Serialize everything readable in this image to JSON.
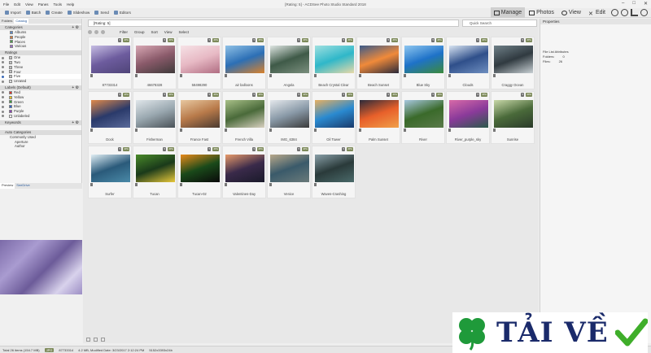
{
  "window": {
    "title": "[Rating: 5] - ACDSee Photo Studio Standard 2018",
    "menu": [
      "File",
      "Edit",
      "View",
      "Panes",
      "Tools",
      "Help"
    ],
    "controls": [
      "–",
      "□",
      "✕"
    ]
  },
  "toolbar": {
    "items": [
      "Import",
      "Batch",
      "Create",
      "Slideshow",
      "Send",
      "Editors"
    ],
    "modes": [
      "Manage",
      "Photos",
      "View",
      "Edit"
    ],
    "mode_active": "Manage"
  },
  "left_panel": {
    "tabs": [
      "Folders",
      "Catalog"
    ],
    "active_tab": "Catalog",
    "categories": {
      "title": "Categories",
      "items": [
        "Albums",
        "People",
        "Places",
        "Various"
      ]
    },
    "ratings": {
      "title": "Ratings",
      "items": [
        "One",
        "Two",
        "Three",
        "Four",
        "Five",
        "Unrated"
      ],
      "selected": "Five"
    },
    "labels": {
      "title": "Labels (Default)",
      "items": [
        {
          "name": "Red",
          "color": "#d9312b"
        },
        {
          "name": "Yellow",
          "color": "#f2c418"
        },
        {
          "name": "Green",
          "color": "#3b9a3b"
        },
        {
          "name": "Blue",
          "color": "#2f5fc8"
        },
        {
          "name": "Purple",
          "color": "#8a3fb3"
        },
        {
          "name": "Unlabeled",
          "color": "#ffffff"
        }
      ]
    },
    "keywords": {
      "title": "Keywords"
    },
    "auto_categories": {
      "title": "Auto Categories",
      "items": [
        "Commonly Used",
        "Aperture",
        "Author"
      ]
    },
    "preview_tabs": [
      "Preview",
      "SeeDrive"
    ]
  },
  "main": {
    "path": "[Rating: 5]",
    "search_placeholder": "Quick Search",
    "filter_bar": [
      "Filter",
      "Group",
      "Sort",
      "View",
      "Select"
    ],
    "thumbnails": [
      {
        "label": "87733314",
        "badges": [
          "5",
          "JPG"
        ],
        "colors": [
          "#6d5c9e",
          "#c6bde3",
          "#4f4478"
        ]
      },
      {
        "label": "46678328",
        "badges": [
          "5",
          "JPG"
        ],
        "colors": [
          "#8a5a6a",
          "#d8a8b4",
          "#3f3a3a"
        ]
      },
      {
        "label": "58498290",
        "badges": [
          "5",
          "JPG"
        ],
        "colors": [
          "#e7b9c4",
          "#f6e2e6",
          "#b06d82"
        ]
      },
      {
        "label": "air balloons",
        "badges": [
          "5",
          "JPG"
        ],
        "colors": [
          "#2c6fb5",
          "#8fc1e6",
          "#d9822c"
        ]
      },
      {
        "label": "Angola",
        "badges": [
          "5",
          "JPG"
        ],
        "colors": [
          "#3f5a48",
          "#dfe6e3",
          "#7b8f7e"
        ]
      },
      {
        "label": "Beach Crystal Clear",
        "badges": [
          "5",
          "JPG"
        ],
        "colors": [
          "#2fb7c9",
          "#9fe0e0",
          "#e8d9a8"
        ]
      },
      {
        "label": "Beach Sunset",
        "badges": [
          "5",
          "JPG"
        ],
        "colors": [
          "#f08a3a",
          "#3a5a8a",
          "#2a2a3a"
        ]
      },
      {
        "label": "Blue Sky",
        "badges": [
          "5",
          "JPG"
        ],
        "colors": [
          "#1e72c8",
          "#8ec7f0",
          "#3c8a3c"
        ]
      },
      {
        "label": "Clouds",
        "badges": [
          "5",
          "JPG"
        ],
        "colors": [
          "#2f4f8a",
          "#d8e4f2",
          "#6f8fc0"
        ]
      },
      {
        "label": "Craggy Ocean",
        "badges": [
          "5",
          "JPG"
        ],
        "colors": [
          "#303a40",
          "#6f8088",
          "#c8d0d4"
        ]
      },
      {
        "label": "Dock",
        "badges": [
          "5",
          "JPG"
        ],
        "colors": [
          "#2a3a6a",
          "#e08a4a",
          "#5a6a9a"
        ]
      },
      {
        "label": "Fisherman",
        "badges": [
          "5",
          "JPG"
        ],
        "colors": [
          "#9aa8b0",
          "#e0e6ea",
          "#4a5258"
        ]
      },
      {
        "label": "France Fast",
        "badges": [
          "5",
          "JPG"
        ],
        "colors": [
          "#b87a4a",
          "#e8c8a0",
          "#4a3a30"
        ]
      },
      {
        "label": "French Villa",
        "badges": [
          "5",
          "JPG"
        ],
        "colors": [
          "#4a6a3a",
          "#a8c088",
          "#d8d0c0"
        ]
      },
      {
        "label": "IMG_6384",
        "badges": [
          "5",
          "JPG"
        ],
        "colors": [
          "#8a9aa8",
          "#e4e8ec",
          "#3a3a3a"
        ]
      },
      {
        "label": "Oil Tower",
        "badges": [
          "5",
          "JPG"
        ],
        "colors": [
          "#2a8ad0",
          "#e8b060",
          "#1a3a6a"
        ]
      },
      {
        "label": "Palm Sunset",
        "badges": [
          "5",
          "JPG"
        ],
        "colors": [
          "#e8602a",
          "#2a2a3a",
          "#f0a04a"
        ]
      },
      {
        "label": "River",
        "badges": [
          "5",
          "JPG"
        ],
        "colors": [
          "#3a6a2a",
          "#a8c8e0",
          "#5a7a4a"
        ]
      },
      {
        "label": "River_purple_sky",
        "badges": [
          "5",
          "JPG"
        ],
        "colors": [
          "#8a3a9a",
          "#d86aa8",
          "#2a5a4a"
        ]
      },
      {
        "label": "Sunrise",
        "badges": [
          "5",
          "JPG"
        ],
        "colors": [
          "#4a6a3a",
          "#c8d8a8",
          "#2a3a2a"
        ]
      },
      {
        "label": "Surfer",
        "badges": [
          "5",
          "JPG"
        ],
        "colors": [
          "#2a5a7a",
          "#e0eef4",
          "#4a8aa8"
        ]
      },
      {
        "label": "Tucan",
        "badges": [
          "5",
          "JPG"
        ],
        "colors": [
          "#1a3a1a",
          "#4a8a2a",
          "#e8c83a"
        ]
      },
      {
        "label": "Tucan-02",
        "badges": [
          "5",
          "JPG"
        ],
        "colors": [
          "#1a4a1a",
          "#e88a1a",
          "#0a0a0a"
        ]
      },
      {
        "label": "Valentines-Day",
        "badges": [
          "5",
          "JPG"
        ],
        "colors": [
          "#3a2a4a",
          "#e89a6a",
          "#1a1a2a"
        ]
      },
      {
        "label": "Venice",
        "badges": [
          "5",
          "JPG"
        ],
        "colors": [
          "#3a5a6a",
          "#b8a88a",
          "#6a7a7a"
        ]
      },
      {
        "label": "Waves-Crashing",
        "badges": [
          "5",
          "JPG"
        ],
        "colors": [
          "#2a3a3a",
          "#8aa0a8",
          "#4a6a6a"
        ]
      }
    ]
  },
  "right_panel": {
    "title": "Properties",
    "section": "File List Attributes",
    "rows": [
      {
        "key": "Folders:",
        "value": "0"
      },
      {
        "key": "Files:",
        "value": "26"
      }
    ]
  },
  "status_bar": {
    "total": "Total 26 items  (154.7 MB)",
    "badge": "JPG",
    "file": "87733314",
    "info": "4.2 MB, Modified Date: 3/23/2017 2:12:24 PM",
    "dims": "5152x3393x24b"
  },
  "watermark": {
    "text": "TẢI VỀ"
  }
}
